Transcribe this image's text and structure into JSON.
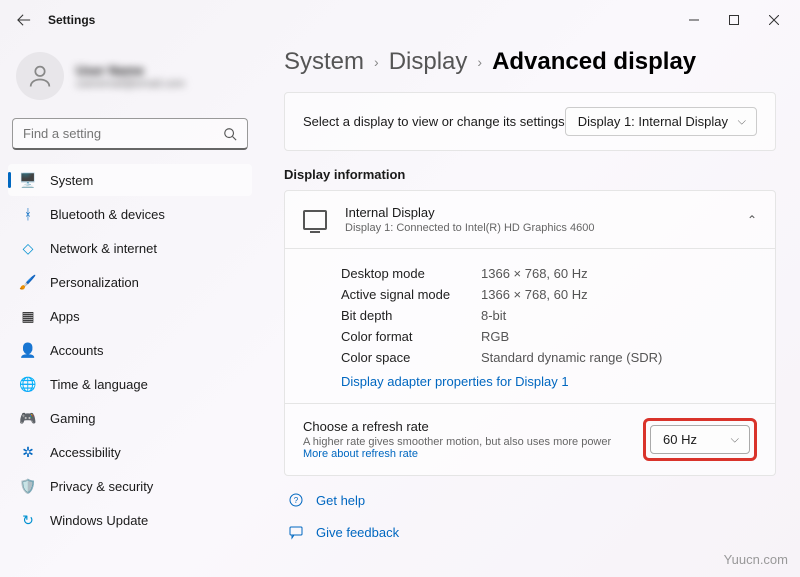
{
  "titlebar": {
    "title": "Settings"
  },
  "profile": {
    "name": "User Name",
    "email": "useremail@email.com"
  },
  "search": {
    "placeholder": "Find a setting"
  },
  "nav": {
    "system": "System",
    "bluetooth": "Bluetooth & devices",
    "network": "Network & internet",
    "personalization": "Personalization",
    "apps": "Apps",
    "accounts": "Accounts",
    "time": "Time & language",
    "gaming": "Gaming",
    "accessibility": "Accessibility",
    "privacy": "Privacy & security",
    "update": "Windows Update"
  },
  "breadcrumb": {
    "l1": "System",
    "l2": "Display",
    "current": "Advanced display"
  },
  "selectDisplay": {
    "label": "Select a display to view or change its settings",
    "value": "Display 1: Internal Display"
  },
  "sectionInfo": "Display information",
  "displayHeader": {
    "title": "Internal Display",
    "sub": "Display 1: Connected to Intel(R) HD Graphics 4600"
  },
  "info": {
    "desktopMode": {
      "k": "Desktop mode",
      "v": "1366 × 768, 60 Hz"
    },
    "activeSignal": {
      "k": "Active signal mode",
      "v": "1366 × 768, 60 Hz"
    },
    "bitDepth": {
      "k": "Bit depth",
      "v": "8-bit"
    },
    "colorFormat": {
      "k": "Color format",
      "v": "RGB"
    },
    "colorSpace": {
      "k": "Color space",
      "v": "Standard dynamic range (SDR)"
    },
    "adapterLink": "Display adapter properties for Display 1"
  },
  "refresh": {
    "title": "Choose a refresh rate",
    "desc": "A higher rate gives smoother motion, but also uses more power  ",
    "moreLink": "More about refresh rate",
    "value": "60 Hz"
  },
  "help": {
    "getHelp": "Get help",
    "feedback": "Give feedback"
  },
  "watermark": "Yuucn.com"
}
